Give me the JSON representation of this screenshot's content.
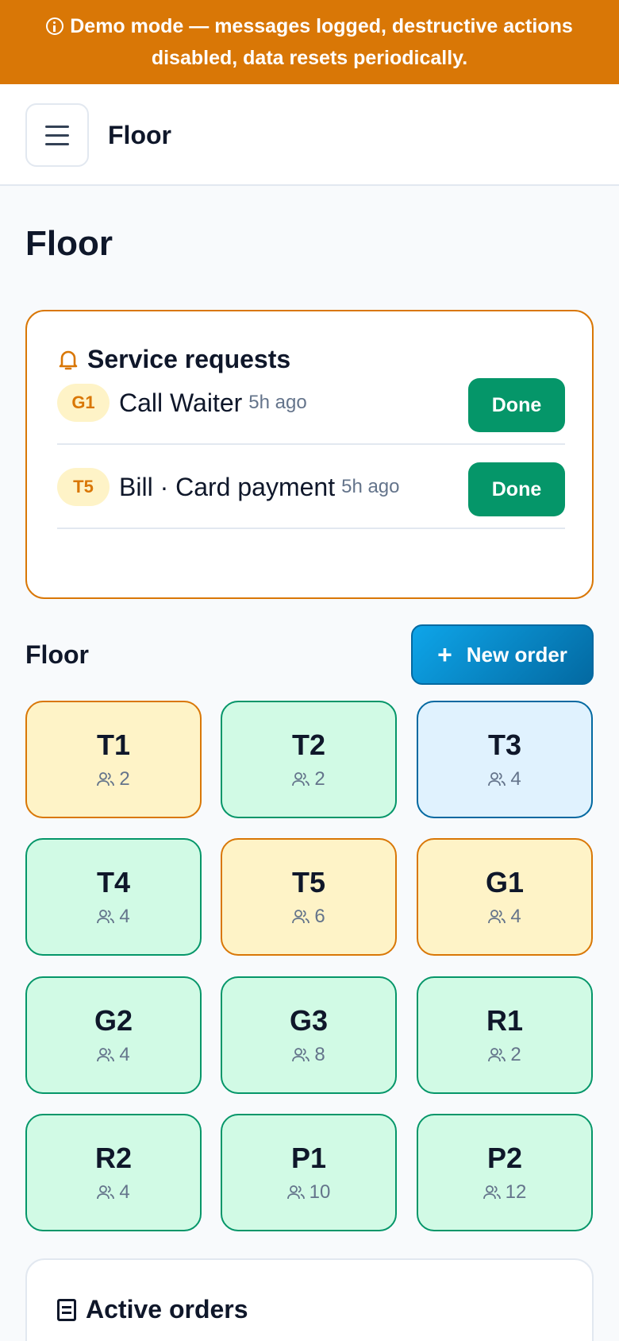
{
  "banner": {
    "text": "Demo mode — messages logged, destructive actions disabled, data resets periodically.",
    "icon": "info-icon"
  },
  "topbar": {
    "title": "Floor",
    "menu_icon": "menu-icon"
  },
  "page": {
    "title": "Floor"
  },
  "service_requests": {
    "title": "Service requests",
    "icon": "bell-icon",
    "items": [
      {
        "table": "G1",
        "text": "Call Waiter",
        "ago": "5h ago",
        "action": "Done"
      },
      {
        "table": "T5",
        "text": "Bill · Card payment",
        "ago": "5h ago",
        "action": "Done"
      }
    ]
  },
  "floor": {
    "label": "Floor",
    "new_order_label": "New order",
    "tables": [
      {
        "name": "T1",
        "seats": "2",
        "status": "attention"
      },
      {
        "name": "T2",
        "seats": "2",
        "status": "free"
      },
      {
        "name": "T3",
        "seats": "4",
        "status": "ordered"
      },
      {
        "name": "T4",
        "seats": "4",
        "status": "free"
      },
      {
        "name": "T5",
        "seats": "6",
        "status": "attention"
      },
      {
        "name": "G1",
        "seats": "4",
        "status": "attention"
      },
      {
        "name": "G2",
        "seats": "4",
        "status": "free"
      },
      {
        "name": "G3",
        "seats": "8",
        "status": "free"
      },
      {
        "name": "R1",
        "seats": "2",
        "status": "free"
      },
      {
        "name": "R2",
        "seats": "4",
        "status": "free"
      },
      {
        "name": "P1",
        "seats": "10",
        "status": "free"
      },
      {
        "name": "P2",
        "seats": "12",
        "status": "free"
      }
    ]
  },
  "active_orders": {
    "title": "Active orders",
    "icon": "receipt-icon"
  },
  "colors": {
    "banner": "#d97706",
    "done": "#059669",
    "free": "#d1fae5",
    "attention": "#fef3c7",
    "ordered": "#e0f2fe",
    "new_order": "#0369a1"
  }
}
